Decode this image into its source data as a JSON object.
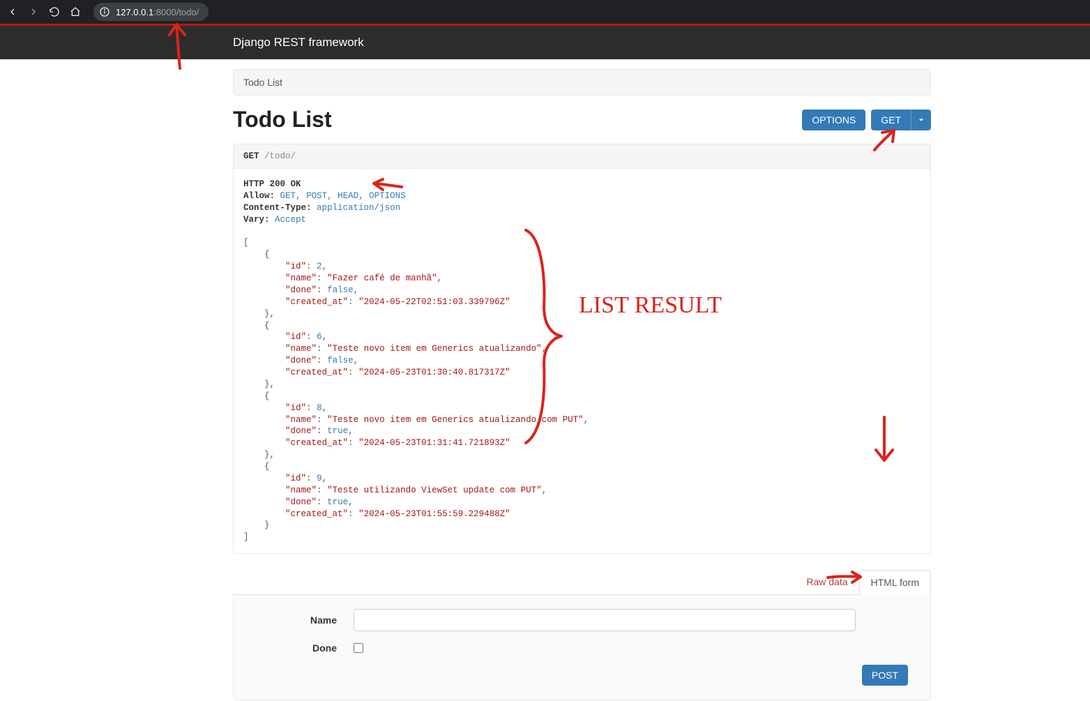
{
  "browser": {
    "url_host": "127.0.0.1",
    "url_rest": ":8000/todo/"
  },
  "navbar": {
    "brand": "Django REST framework"
  },
  "breadcrumb": {
    "text": "Todo List"
  },
  "page": {
    "title": "Todo List"
  },
  "buttons": {
    "options": "OPTIONS",
    "get": "GET",
    "post": "POST"
  },
  "request": {
    "method": "GET",
    "path": "/todo/"
  },
  "response": {
    "status_line": "HTTP 200 OK",
    "headers": {
      "allow_label": "Allow:",
      "allow_values": [
        "GET",
        "POST",
        "HEAD",
        "OPTIONS"
      ],
      "content_type_label": "Content-Type:",
      "content_type_value": "application/json",
      "vary_label": "Vary:",
      "vary_value": "Accept"
    },
    "body": [
      {
        "id": 2,
        "name": "Fazer café de manhã",
        "done": false,
        "created_at": "2024-05-22T02:51:03.339796Z"
      },
      {
        "id": 6,
        "name": "Teste novo item em Generics atualizando",
        "done": false,
        "created_at": "2024-05-23T01:30:40.817317Z"
      },
      {
        "id": 8,
        "name": "Teste novo item em Generics atualizando com PUT",
        "done": true,
        "created_at": "2024-05-23T01:31:41.721893Z"
      },
      {
        "id": 9,
        "name": "Teste utilizando ViewSet update com PUT",
        "done": true,
        "created_at": "2024-05-23T01:55:59.229488Z"
      }
    ]
  },
  "tabs": {
    "raw": "Raw data",
    "html": "HTML form"
  },
  "form": {
    "name_label": "Name",
    "done_label": "Done"
  },
  "annotations": {
    "list_result": "LIST RESULT"
  }
}
